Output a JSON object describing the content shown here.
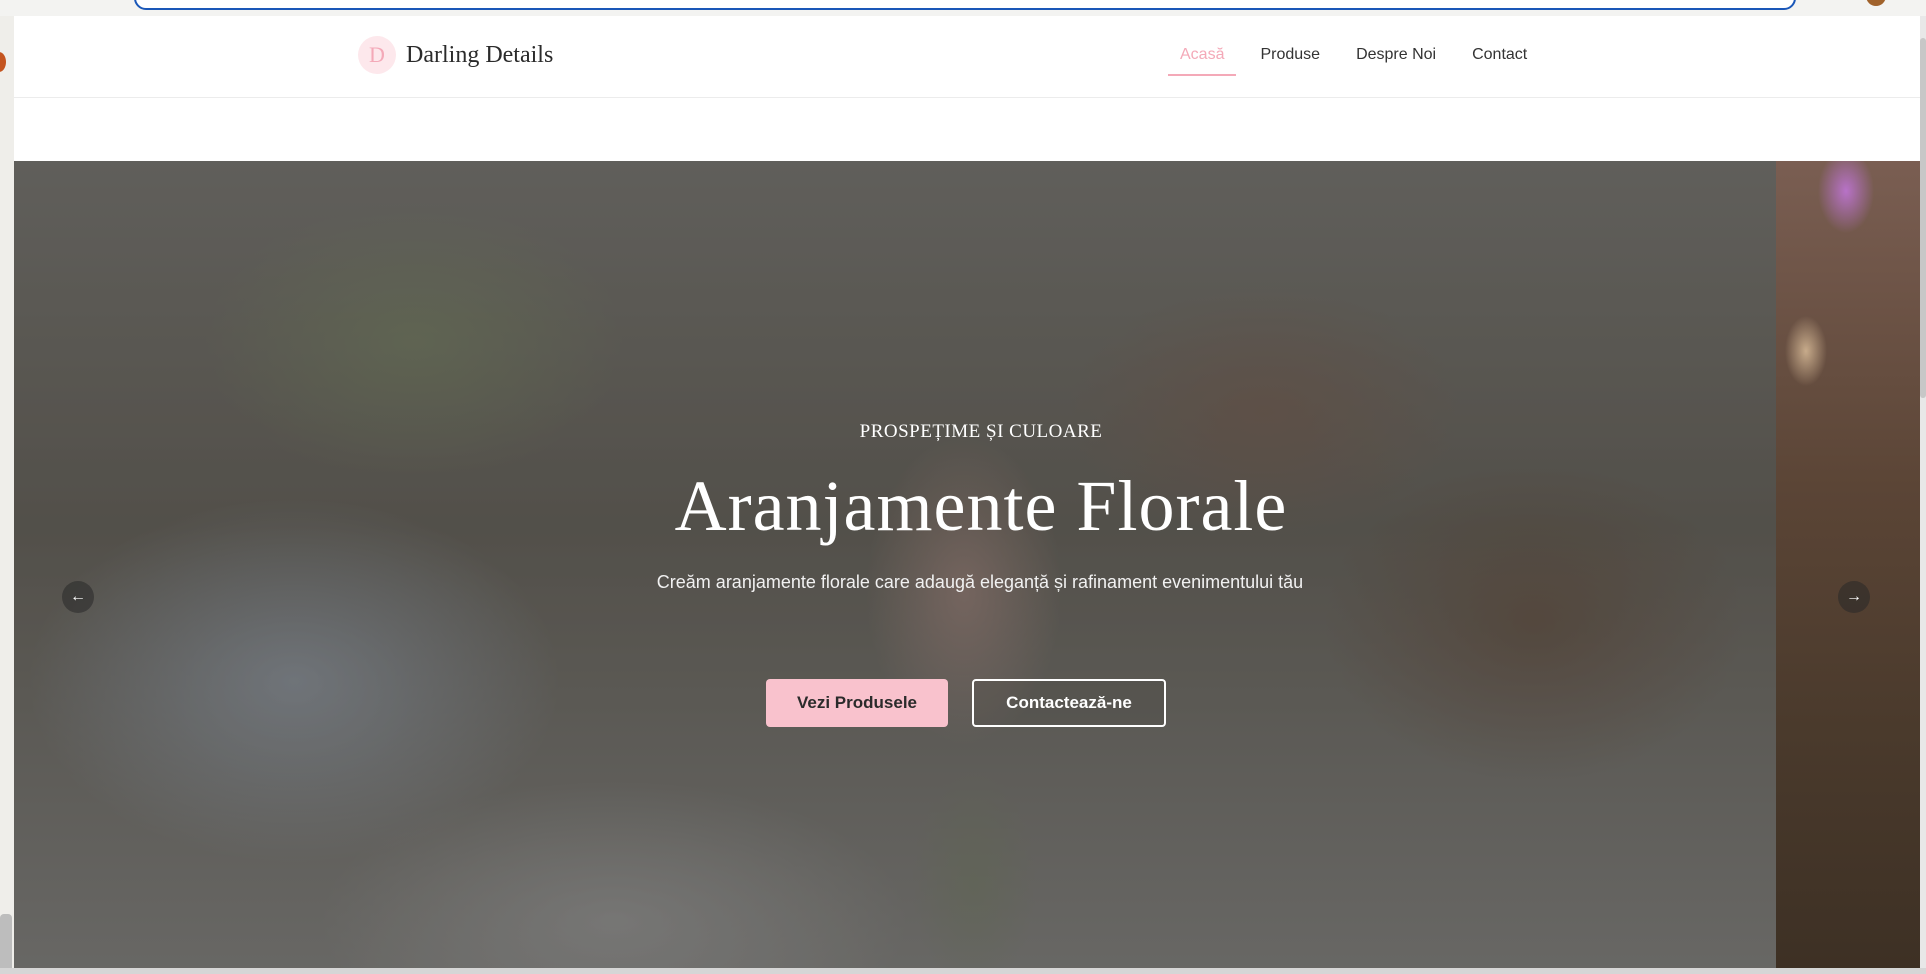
{
  "header": {
    "logo_letter": "D",
    "site_name": "Darling Details",
    "nav": [
      {
        "label": "Acasă",
        "active": true
      },
      {
        "label": "Produse",
        "active": false
      },
      {
        "label": "Despre Noi",
        "active": false
      },
      {
        "label": "Contact",
        "active": false
      }
    ]
  },
  "hero": {
    "kicker": "PROSPEȚIME ȘI CULOARE",
    "title": "Aranjamente Florale",
    "description": "Creăm aranjamente florale care adaugă eleganță și rafinament evenimentului tău",
    "primary_button": "Vezi Produsele",
    "secondary_button": "Contactează-ne",
    "prev_icon": "arrow-left-icon",
    "next_icon": "arrow-right-icon"
  },
  "colors": {
    "accent": "#f4a9b8",
    "button_fill": "#f9c2cd"
  }
}
